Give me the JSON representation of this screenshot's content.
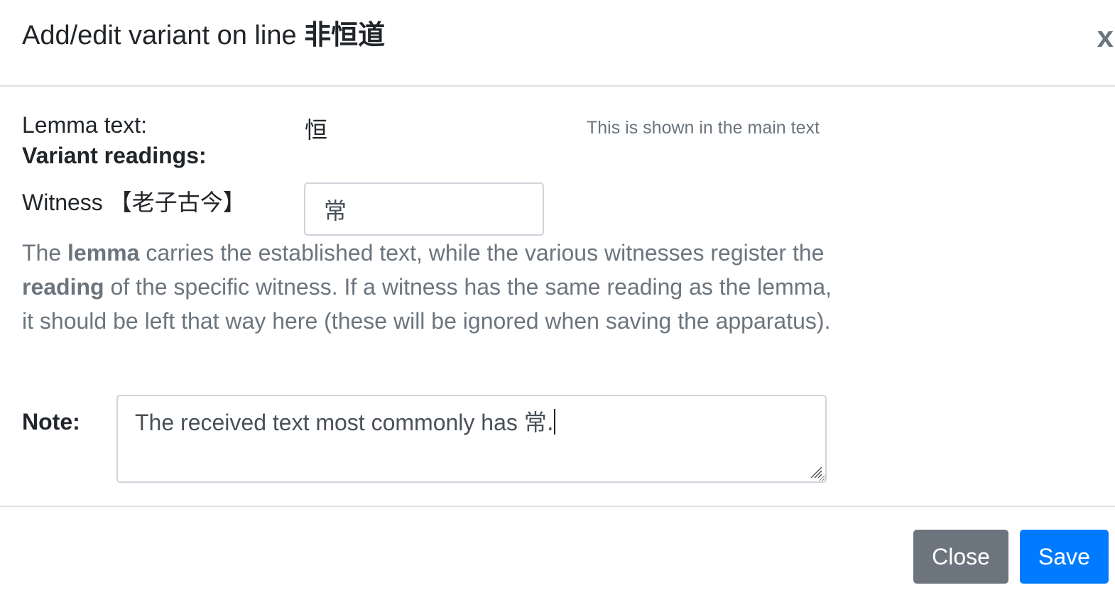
{
  "dialog": {
    "title_prefix": "Add/edit variant on line ",
    "title_line": "非恒道",
    "close_icon_glyph": "x"
  },
  "lemma": {
    "label": "Lemma text:",
    "value": "恒",
    "hint": "This is shown in the main text"
  },
  "variants": {
    "heading": "Variant readings:",
    "witness_label": "Witness",
    "witness_name": "【老子古今】",
    "witness_reading": "常"
  },
  "help": {
    "part1": "The ",
    "term_lemma": "lemma",
    "part2": " carries the established text, while the various witnesses register the ",
    "term_reading": "reading",
    "part3": " of the specific witness. If a witness has the same reading as the lemma, it should be left that way here (these will be ignored when saving the apparatus)."
  },
  "note": {
    "label": "Note:",
    "text_prefix": "The received text most commonly has ",
    "text_cjk": "常."
  },
  "footer": {
    "close_label": "Close",
    "save_label": "Save"
  },
  "colors": {
    "primary": "#007bff",
    "secondary": "#6c757d",
    "muted_text": "#6c757d",
    "border": "#ced4da"
  }
}
